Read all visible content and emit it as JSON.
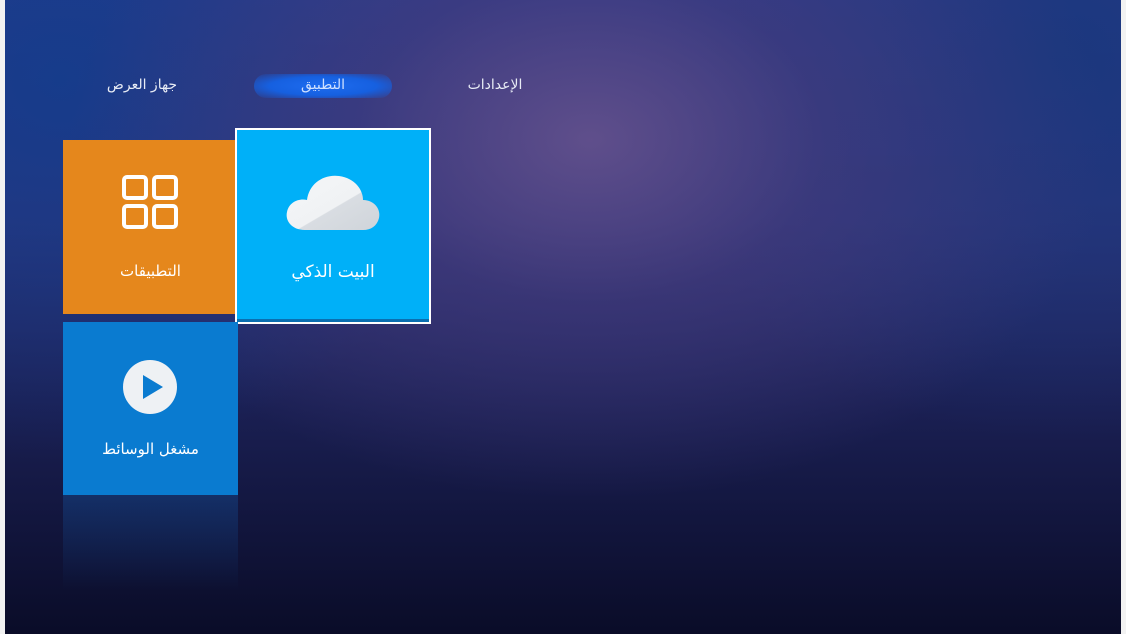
{
  "nav": {
    "tabs": [
      {
        "label": "جهاز العرض",
        "active": false
      },
      {
        "label": "التطبيق",
        "active": true
      },
      {
        "label": "الإعدادات",
        "active": false
      }
    ]
  },
  "tiles": {
    "apps": {
      "label": "التطبيقات",
      "icon": "apps-grid-icon",
      "color": "#e5871c"
    },
    "smart_home": {
      "label": "البيت الذكي",
      "icon": "cloud-icon",
      "color": "#00b0f8",
      "focused": true
    },
    "media_player": {
      "label": "مشغل الوسائط",
      "icon": "play-icon",
      "color": "#0a7bd0"
    }
  },
  "colors": {
    "accent_glow": "#1e6cf0",
    "background_top": "#2a3a8a",
    "background_bottom": "#0a0c28"
  }
}
